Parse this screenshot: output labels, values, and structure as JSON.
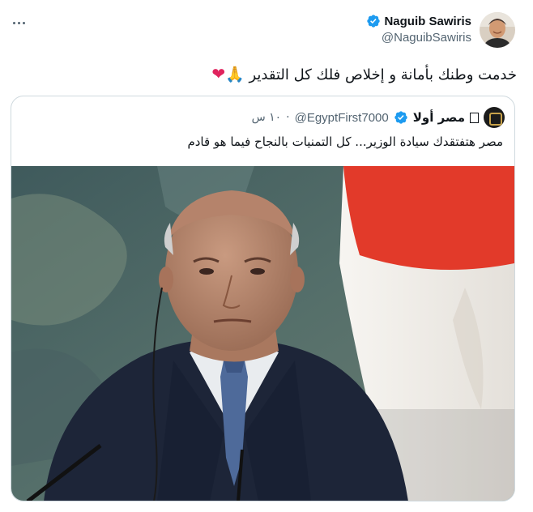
{
  "author": {
    "display_name": "Naguib Sawiris",
    "handle": "@NaguibSawiris",
    "verified_icon": "verified-badge-icon",
    "avatar_icon": "user-avatar"
  },
  "tweet": {
    "text": "خدمت وطنك بأمانة و إخلاص فلك كل التقدير",
    "emoji_pray": "🙏",
    "emoji_heart": "❤"
  },
  "more_icon": "more-options-icon",
  "quote": {
    "name": "مصر أولا",
    "handle": "@EgyptFirst7000",
    "dot": "·",
    "time": "١٠ س",
    "text": "مصر هتفتقدك سيادة الوزير... كل التمنيات بالنجاح فيما هو قادم",
    "image": "photo of a man in a dark suit in front of an Egyptian flag"
  },
  "colors": {
    "verified": "#1d9bf0",
    "text_primary": "#0f1419",
    "text_secondary": "#536471",
    "border": "#cfd9de",
    "flag_red": "#e23a2a",
    "flag_white": "#f4f2ee"
  }
}
